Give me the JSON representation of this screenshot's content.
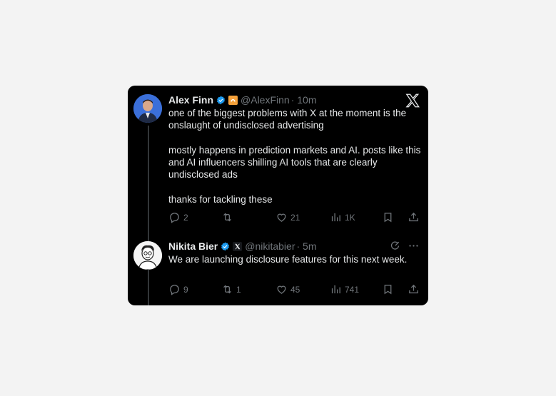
{
  "tweet1": {
    "name": "Alex Finn",
    "handle": "@AlexFinn",
    "time": "· 10m",
    "text": "one of the biggest problems with X at the moment is the onslaught of undisclosed advertising\n\nmostly happens in prediction markets and AI. posts like this and AI influencers shilling AI tools that are clearly undisclosed ads\n\nthanks for tackling these",
    "replies": "2",
    "retweets": "",
    "likes": "21",
    "views": "1K"
  },
  "tweet2": {
    "name": "Nikita Bier",
    "handle": "@nikitabier",
    "time": "· 5m",
    "text": "We are launching disclosure features for this next week.",
    "replies": "9",
    "retweets": "1",
    "likes": "45",
    "views": "741"
  },
  "colors": {
    "card_bg": "#000000",
    "verified": "#1d9bf0",
    "muted": "#71767b",
    "text": "#e7e9ea",
    "affiliate_badge": "#f4a13b"
  },
  "icons": [
    "x-logo-icon",
    "verified-icon",
    "reply-icon",
    "retweet-icon",
    "like-icon",
    "views-icon",
    "bookmark-icon",
    "share-icon",
    "grok-icon",
    "more-icon"
  ]
}
